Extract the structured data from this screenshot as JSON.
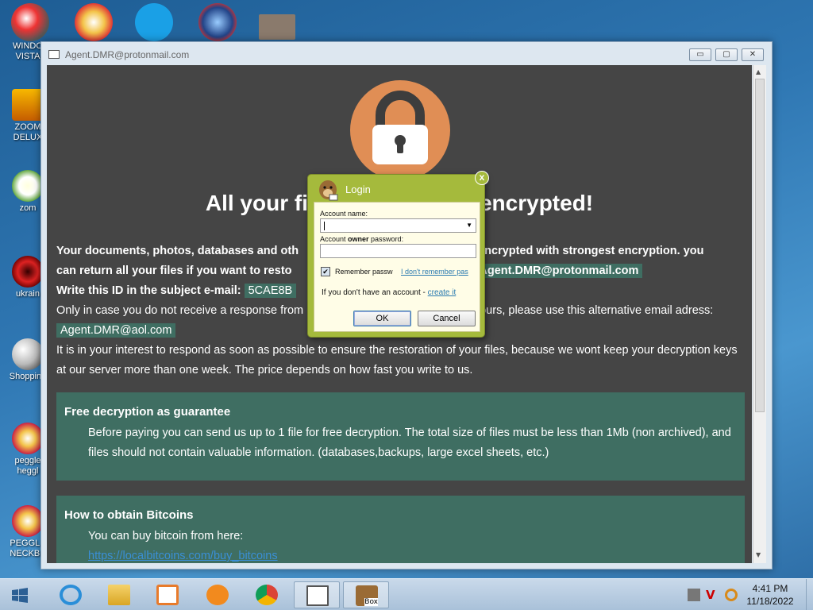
{
  "desktop": {
    "icons": [
      {
        "label1": "WINDO",
        "label2": "VISTA"
      },
      {
        "label1": "ZOOM",
        "label2": "DELUX"
      },
      {
        "label1": "zom",
        "label2": ""
      },
      {
        "label1": "ukrain",
        "label2": ""
      },
      {
        "label1": "Shopping",
        "label2": ""
      },
      {
        "label1": "peggle",
        "label2": "heggl"
      },
      {
        "label1": "PEGGLE",
        "label2": "NECKBE"
      }
    ],
    "top_icons": [
      "peggle-icon",
      "skype-icon",
      "globe-icon",
      "photo-icon"
    ]
  },
  "window": {
    "title": "Agent.DMR@protonmail.com",
    "minimize": "▭",
    "maximize": "▢",
    "close": "✕"
  },
  "ransom": {
    "headline_left": "All your fi",
    "headline_right": "encrypted!",
    "p1_a": "Your documents, photos, databases and oth",
    "p1_b": "encrypted with strongest encryption. you",
    "p2_a": "can return all your files if you want to resto",
    "p2_b": "l:",
    "email_primary": "Agent.DMR@protonmail.com",
    "p3_a": "Write this ID in the subject e-mail:",
    "id_value": "5CAE8B",
    "p4_a": "Only in case you do not receive a response from",
    "p4_b": "ours, please use this alternative email adress:",
    "email_alt": "Agent.DMR@aol.com",
    "p5": "It is in your interest to respond as soon as possible to ensure the restoration of your files, because we wont keep your decryption keys at our server more than one week. The price depends on how fast you write to us.",
    "panel1_title": "Free decryption as guarantee",
    "panel1_body": "Before paying you can send us up to 1 file for free decryption. The total size of files must be less than 1Mb (non archived), and files should not contain valuable information. (databases,backups, large excel sheets, etc.)",
    "panel2_title": "How to obtain Bitcoins",
    "panel2_body": "You can buy bitcoin from here:",
    "panel2_link": "https://localbitcoins.com/buy_bitcoins"
  },
  "login": {
    "title": "Login",
    "close": "x",
    "account_label": "Account name:",
    "account_value": "",
    "password_label_pre": "Account ",
    "password_label_bold": "owner",
    "password_label_post": " password:",
    "remember": "Remember passw",
    "remember_checked": true,
    "forgot": "I don't remember pas",
    "no_account": "If you don't have an account - ",
    "create": "create it",
    "ok": "OK",
    "cancel": "Cancel"
  },
  "taskbar": {
    "apps": [
      "ie-icon",
      "file-explorer-icon",
      "media-player-icon",
      "ucbrowser-icon",
      "chrome-icon",
      "app-window-icon",
      "box-icon"
    ],
    "box_label": "Box",
    "time": "4:41 PM",
    "date": "11/18/2022"
  },
  "colors": {
    "content_bg": "#454545",
    "panel_bg": "#3f6e62",
    "lock_circle": "#e08e55",
    "dialog_green": "#a5ba3c"
  }
}
